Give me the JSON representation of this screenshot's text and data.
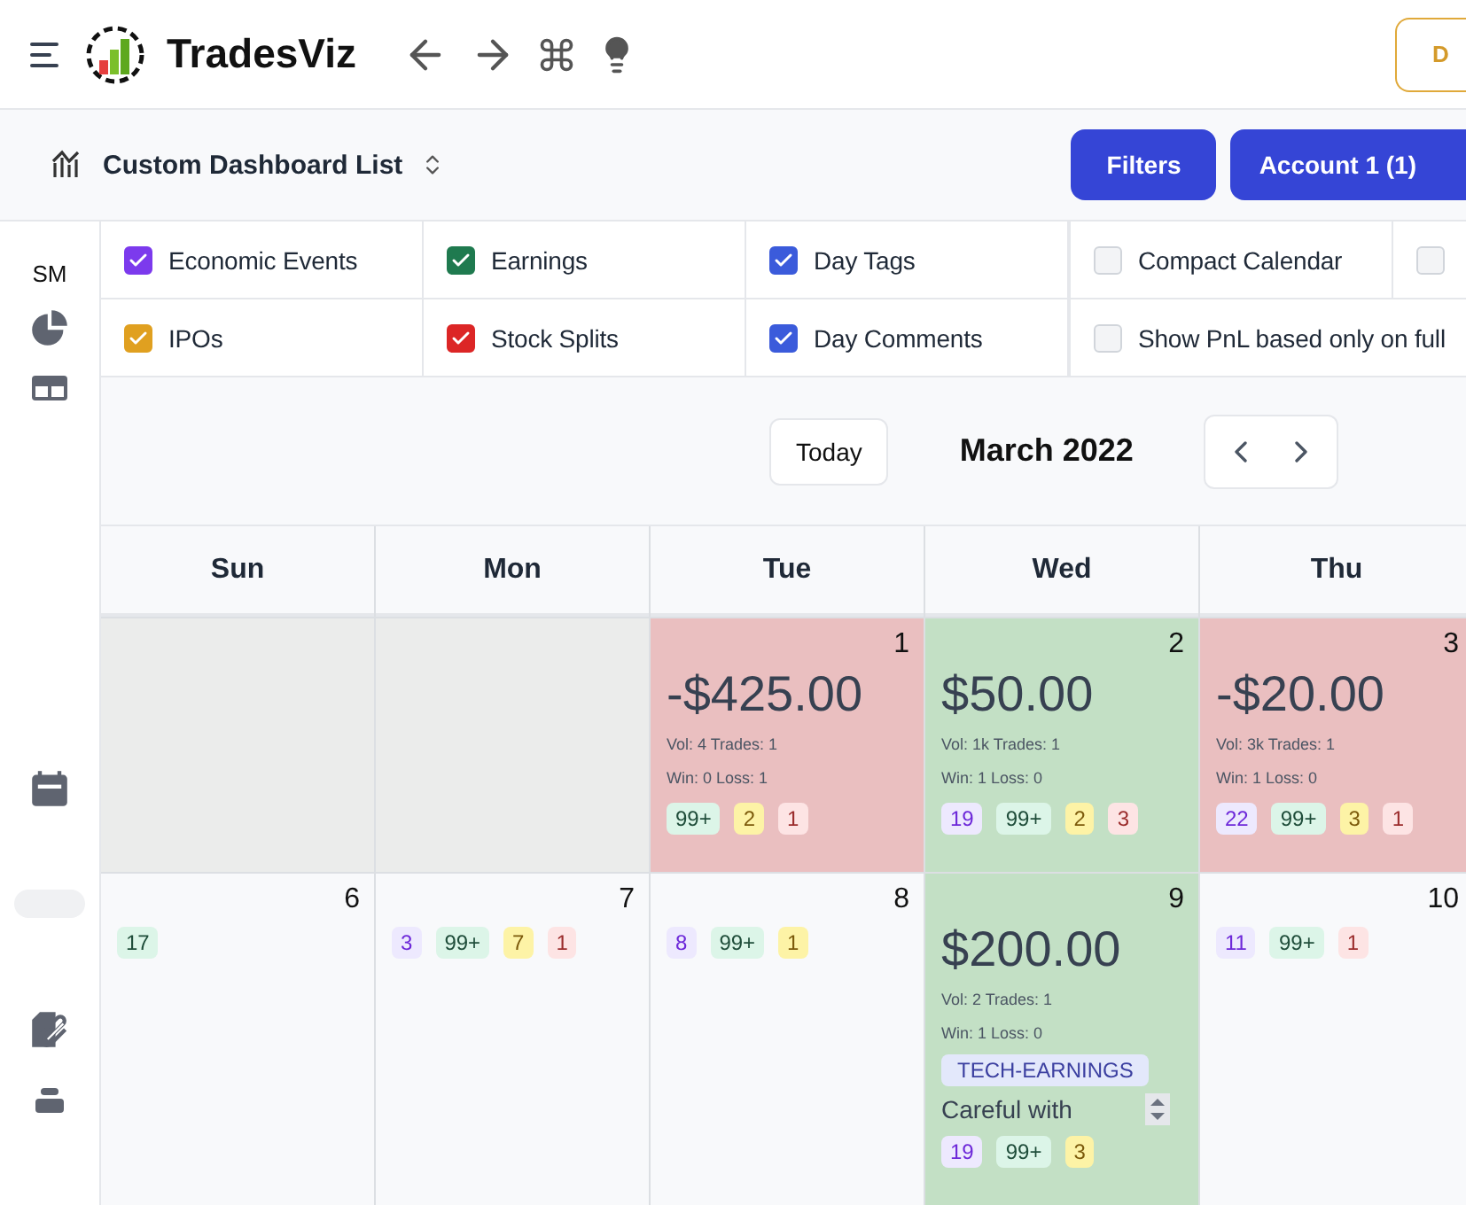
{
  "header": {
    "app_name": "TradesViz",
    "right_button": "D"
  },
  "toolbar": {
    "dashboard_label": "Custom Dashboard List",
    "buttons": [
      "Filters",
      "Account 1 (1)"
    ]
  },
  "sidebar": {
    "label": "SM"
  },
  "filters": [
    [
      {
        "label": "Economic Events",
        "checked": true,
        "color": "#7c3aed"
      },
      {
        "label": "Earnings",
        "checked": true,
        "color": "#1f7a4f"
      },
      {
        "label": "Day Tags",
        "checked": true,
        "color": "#3b5bdb"
      },
      {
        "label": "Compact Calendar",
        "checked": false
      },
      {
        "checked": false
      }
    ],
    [
      {
        "label": "IPOs",
        "checked": true,
        "color": "#e0a020"
      },
      {
        "label": "Stock Splits",
        "checked": true,
        "color": "#dc2626"
      },
      {
        "label": "Day Comments",
        "checked": true,
        "color": "#3b5bdb"
      },
      {
        "label": "Show PnL based only on full",
        "checked": false
      }
    ]
  ],
  "calendar": {
    "today_button": "Today",
    "month": "March 2022",
    "weekdays": [
      "Sun",
      "Mon",
      "Tue",
      "Wed",
      "Thu"
    ],
    "weeks": [
      [
        {
          "kind": "blank"
        },
        {
          "kind": "blank"
        },
        {
          "kind": "loss",
          "day": "1",
          "pnl": "-$425.00",
          "stats": [
            "Vol: 4 Trades: 1",
            "Win: 0 Loss: 1"
          ],
          "badges": [
            {
              "kind": "earnings",
              "text": "99+"
            },
            {
              "kind": "ipo",
              "text": "2"
            },
            {
              "kind": "split",
              "text": "1"
            }
          ]
        },
        {
          "kind": "gain",
          "day": "2",
          "pnl": "$50.00",
          "stats": [
            "Vol: 1k Trades: 1",
            "Win: 1 Loss: 0"
          ],
          "badges": [
            {
              "kind": "economic",
              "text": "19"
            },
            {
              "kind": "earnings",
              "text": "99+"
            },
            {
              "kind": "ipo",
              "text": "2"
            },
            {
              "kind": "split",
              "text": "3"
            }
          ]
        },
        {
          "kind": "loss",
          "day": "3",
          "pnl": "-$20.00",
          "stats": [
            "Vol: 3k Trades: 1",
            "Win: 1 Loss: 0"
          ],
          "badges": [
            {
              "kind": "economic",
              "text": "22"
            },
            {
              "kind": "earnings",
              "text": "99+"
            },
            {
              "kind": "ipo",
              "text": "3"
            },
            {
              "kind": "split",
              "text": "1"
            }
          ]
        }
      ],
      [
        {
          "kind": "plain",
          "day": "6",
          "badges": [
            {
              "kind": "earnings",
              "text": "17"
            }
          ]
        },
        {
          "kind": "plain",
          "day": "7",
          "badges": [
            {
              "kind": "economic",
              "text": "3"
            },
            {
              "kind": "earnings",
              "text": "99+"
            },
            {
              "kind": "ipo",
              "text": "7"
            },
            {
              "kind": "split",
              "text": "1"
            }
          ]
        },
        {
          "kind": "plain",
          "day": "8",
          "badges": [
            {
              "kind": "economic",
              "text": "8"
            },
            {
              "kind": "earnings",
              "text": "99+"
            },
            {
              "kind": "ipo",
              "text": "1"
            }
          ]
        },
        {
          "kind": "gain",
          "day": "9",
          "pnl": "$200.00",
          "stats": [
            "Vol: 2 Trades: 1",
            "Win: 1 Loss: 0"
          ],
          "tag": "TECH-EARNINGS",
          "note": "Careful with",
          "badges": [
            {
              "kind": "economic",
              "text": "19"
            },
            {
              "kind": "earnings",
              "text": "99+"
            },
            {
              "kind": "ipo",
              "text": "3"
            }
          ]
        },
        {
          "kind": "plain",
          "day": "10",
          "badges": [
            {
              "kind": "economic",
              "text": "11"
            },
            {
              "kind": "earnings",
              "text": "99+"
            },
            {
              "kind": "split",
              "text": "1"
            }
          ]
        }
      ]
    ]
  }
}
